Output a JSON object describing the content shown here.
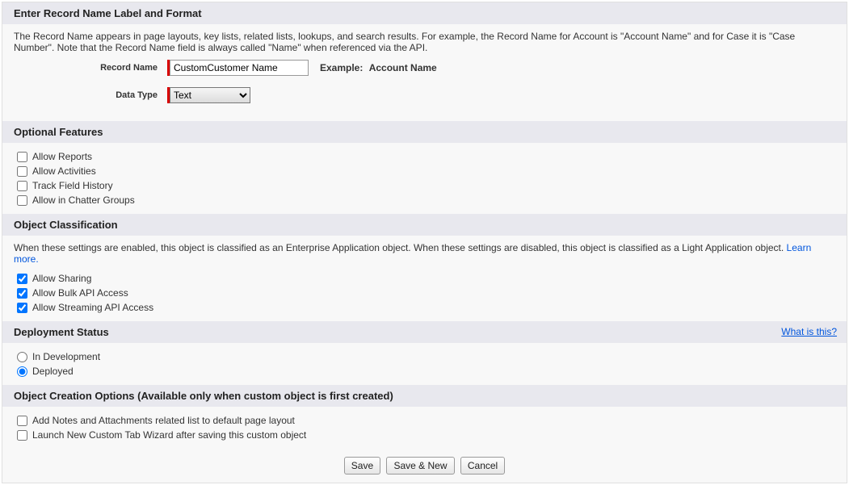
{
  "section1": {
    "title": "Enter Record Name Label and Format",
    "desc": "The Record Name appears in page layouts, key lists, related lists, lookups, and search results. For example, the Record Name for Account is \"Account Name\" and for Case it is \"Case Number\". Note that the Record Name field is always called \"Name\" when referenced via the API.",
    "recordNameLabel": "Record Name",
    "recordNameValue": "CustomCustomer Name",
    "exampleLabel": "Example:",
    "exampleValue": "Account Name",
    "dataTypeLabel": "Data Type",
    "dataTypeValue": "Text"
  },
  "section2": {
    "title": "Optional Features",
    "options": [
      {
        "label": "Allow Reports",
        "checked": false
      },
      {
        "label": "Allow Activities",
        "checked": false
      },
      {
        "label": "Track Field History",
        "checked": false
      },
      {
        "label": "Allow in Chatter Groups",
        "checked": false
      }
    ]
  },
  "section3": {
    "title": "Object Classification",
    "desc": "When these settings are enabled, this object is classified as an Enterprise Application object. When these settings are disabled, this object is classified as a Light Application object. ",
    "learnMore": "Learn more.",
    "options": [
      {
        "label": "Allow Sharing",
        "checked": true
      },
      {
        "label": "Allow Bulk API Access",
        "checked": true
      },
      {
        "label": "Allow Streaming API Access",
        "checked": true
      }
    ]
  },
  "section4": {
    "title": "Deployment Status",
    "whatIsThis": "What is this?",
    "options": [
      {
        "label": "In Development",
        "selected": false
      },
      {
        "label": "Deployed",
        "selected": true
      }
    ]
  },
  "section5": {
    "title": "Object Creation Options (Available only when custom object is first created)",
    "options": [
      {
        "label": "Add Notes and Attachments related list to default page layout",
        "checked": false
      },
      {
        "label": "Launch New Custom Tab Wizard after saving this custom object",
        "checked": false
      }
    ]
  },
  "buttons": {
    "save": "Save",
    "saveNew": "Save & New",
    "cancel": "Cancel"
  }
}
